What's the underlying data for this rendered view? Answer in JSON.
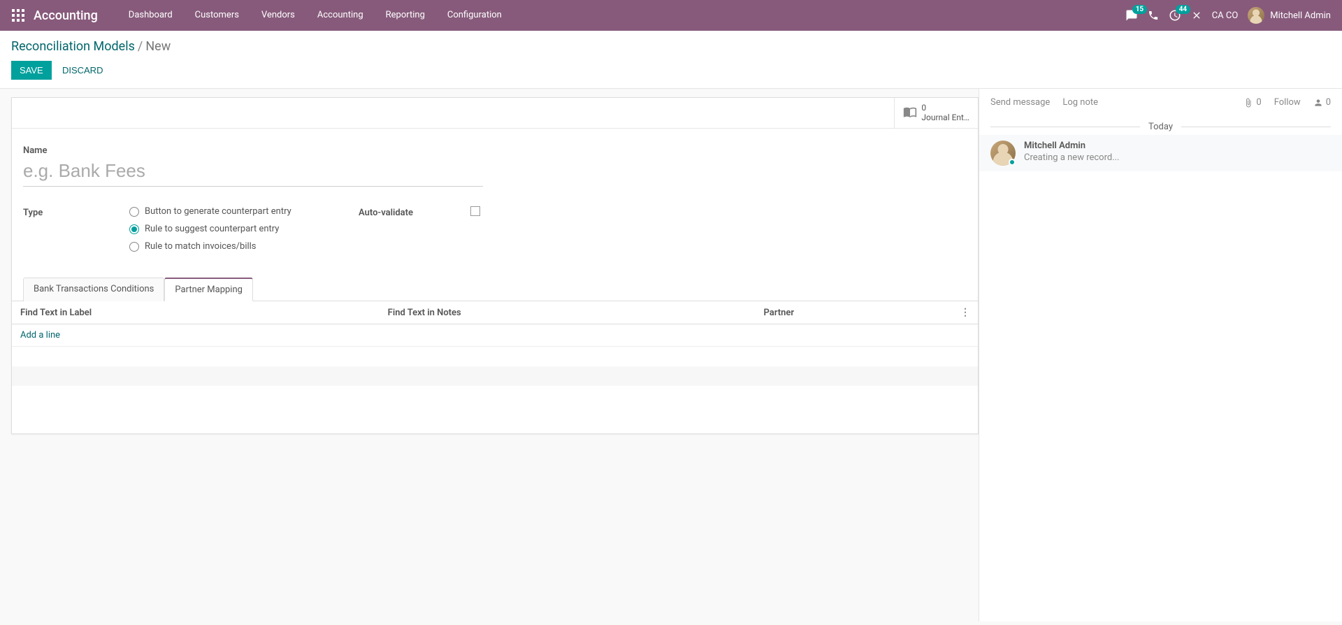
{
  "nav": {
    "brand": "Accounting",
    "menu": [
      "Dashboard",
      "Customers",
      "Vendors",
      "Accounting",
      "Reporting",
      "Configuration"
    ],
    "msg_badge": "15",
    "activity_badge": "44",
    "company": "CA CO",
    "user_name": "Mitchell Admin"
  },
  "breadcrumb": {
    "parent": "Reconciliation Models",
    "current": "New"
  },
  "buttons": {
    "save": "Save",
    "discard": "Discard"
  },
  "stat": {
    "value": "0",
    "label": "Journal Ent…"
  },
  "form": {
    "name_label": "Name",
    "name_placeholder": "e.g. Bank Fees",
    "name_value": "",
    "type_label": "Type",
    "type_options": [
      "Button to generate counterpart entry",
      "Rule to suggest counterpart entry",
      "Rule to match invoices/bills"
    ],
    "type_selected_index": 1,
    "auto_validate_label": "Auto-validate",
    "auto_validate_checked": false
  },
  "tabs": {
    "items": [
      "Bank Transactions Conditions",
      "Partner Mapping"
    ],
    "active_index": 1
  },
  "partner_table": {
    "headers": [
      "Find Text in Label",
      "Find Text in Notes",
      "Partner"
    ],
    "add_line": "Add a line"
  },
  "chatter": {
    "send": "Send message",
    "log": "Log note",
    "attach_count": "0",
    "follow": "Follow",
    "follower_count": "0",
    "divider": "Today",
    "msg_author": "Mitchell Admin",
    "msg_text": "Creating a new record..."
  }
}
